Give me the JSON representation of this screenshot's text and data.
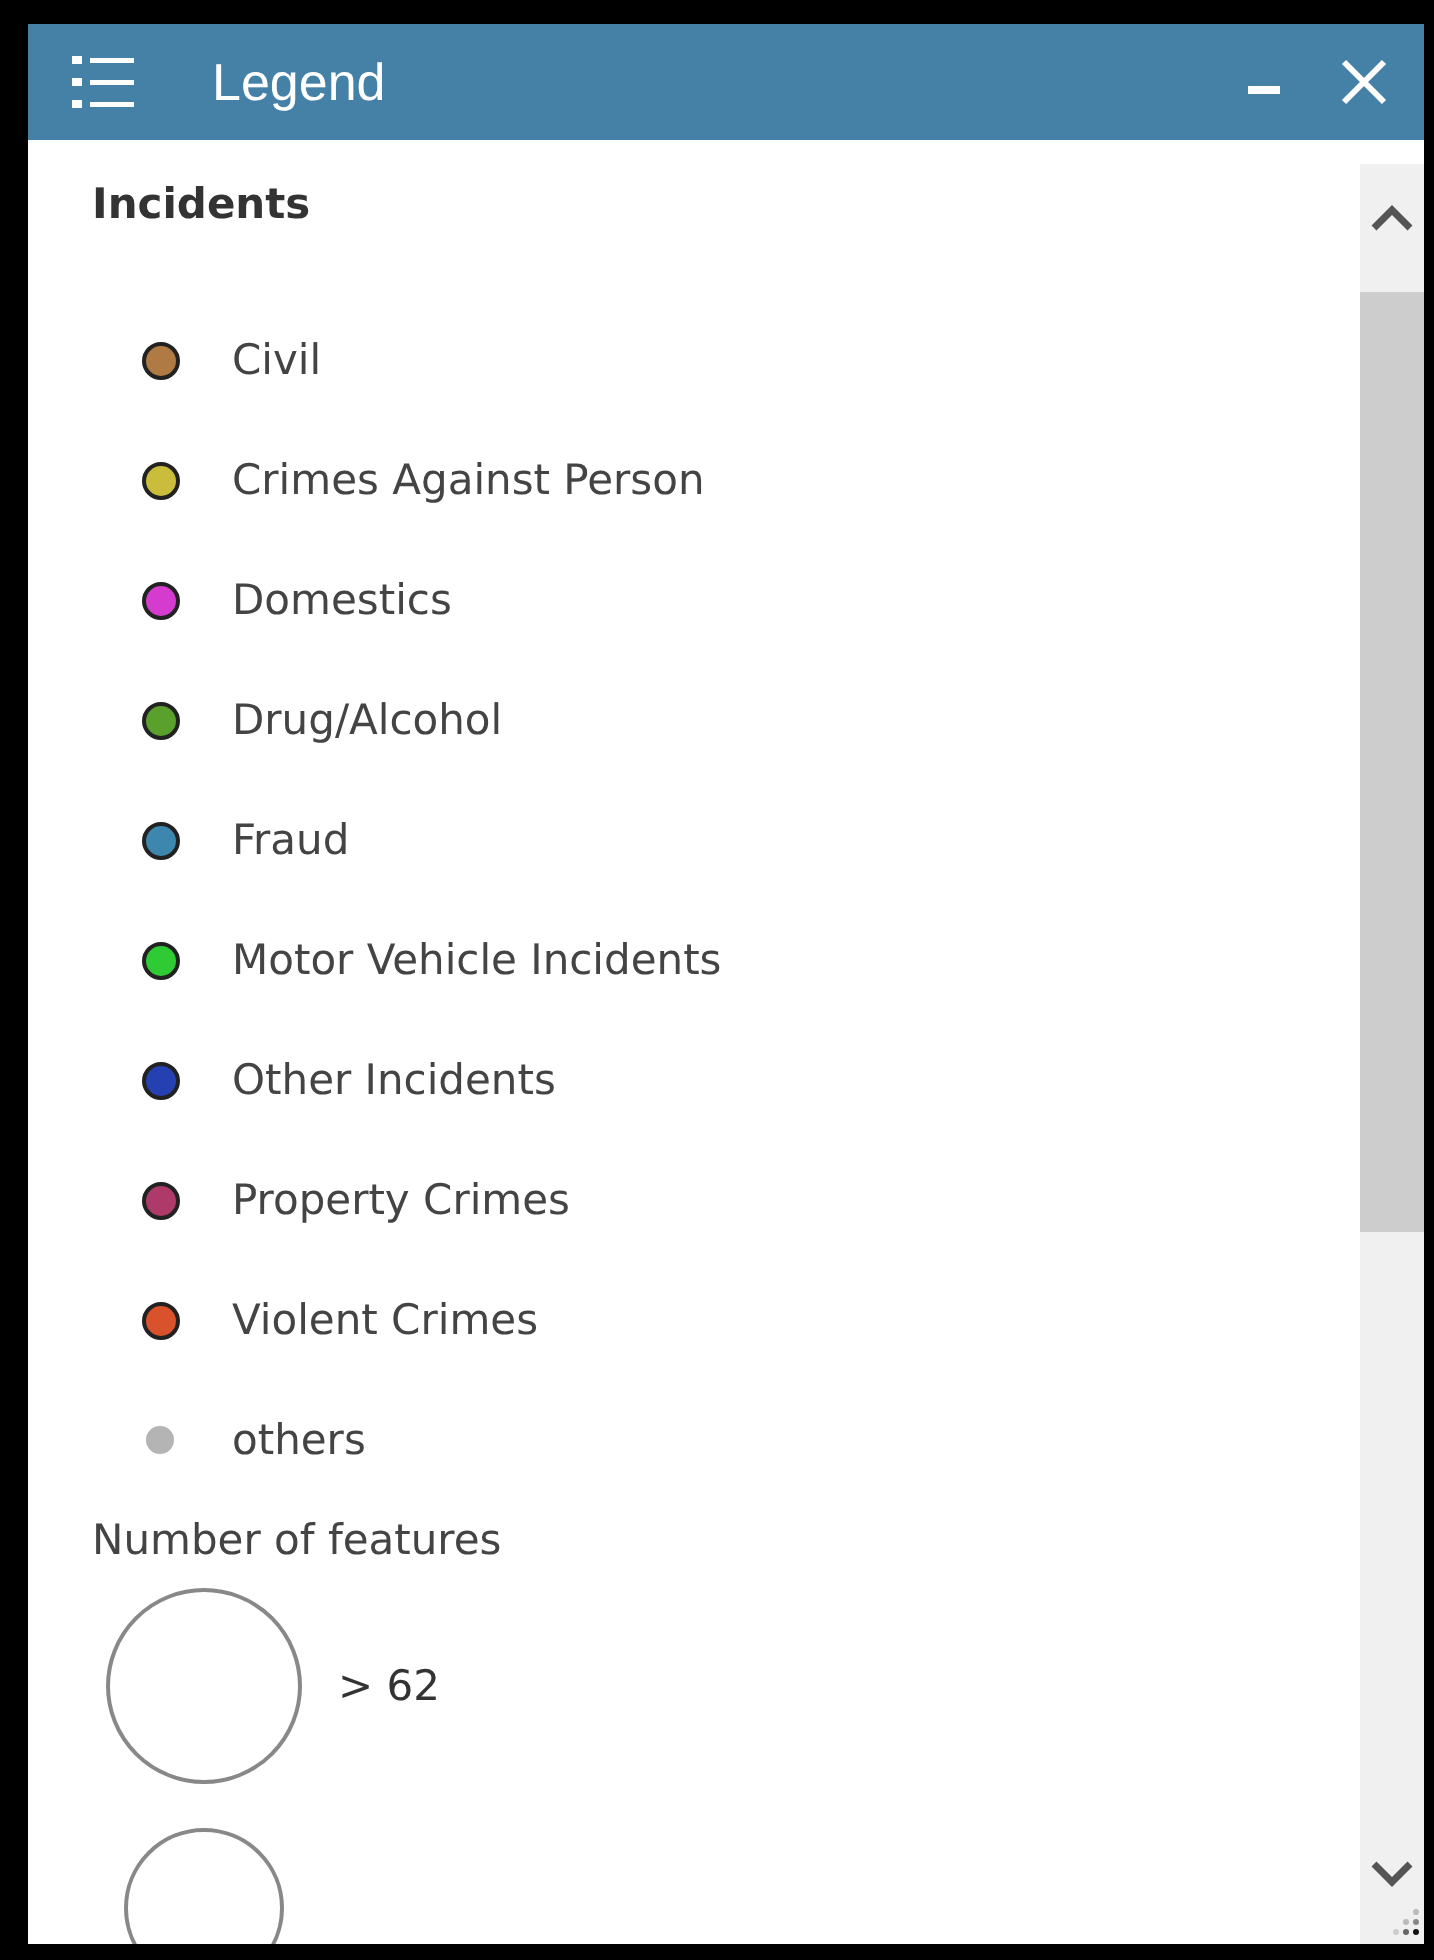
{
  "window": {
    "title": "Legend"
  },
  "layer": {
    "title": "Incidents"
  },
  "items": [
    {
      "label": "Civil",
      "color": "#b07a45",
      "kind": "outlined"
    },
    {
      "label": "Crimes Against Person",
      "color": "#cbbd3c",
      "kind": "outlined"
    },
    {
      "label": "Domestics",
      "color": "#d63bd0",
      "kind": "outlined"
    },
    {
      "label": "Drug/Alcohol",
      "color": "#5aa02c",
      "kind": "outlined"
    },
    {
      "label": "Fraud",
      "color": "#3d86ad",
      "kind": "outlined"
    },
    {
      "label": "Motor Vehicle Incidents",
      "color": "#2fcb35",
      "kind": "outlined"
    },
    {
      "label": "Other Incidents",
      "color": "#2540b0",
      "kind": "outlined"
    },
    {
      "label": "Property Crimes",
      "color": "#ad3a69",
      "kind": "outlined"
    },
    {
      "label": "Violent Crimes",
      "color": "#d9522b",
      "kind": "outlined"
    },
    {
      "label": "others",
      "color": "#b4b4b4",
      "kind": "plain"
    }
  ],
  "size_legend": {
    "title": "Number of features",
    "items": [
      {
        "label": "> 62"
      }
    ]
  }
}
